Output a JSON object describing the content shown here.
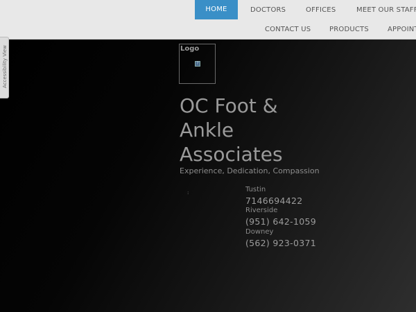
{
  "nav": {
    "row1": [
      "HOME",
      "DOCTORS",
      "OFFICES",
      "MEET OUR STAFF"
    ],
    "row2": [
      "CONTACT US",
      "PRODUCTS",
      "APPOINTM"
    ]
  },
  "accessibility_tab": "Accessibility View",
  "logo": {
    "label": "Logo",
    "broken_image_icon": "broken-image-icon"
  },
  "hero": {
    "title": "OC Foot & Ankle Associates",
    "tagline": "Experience, Dedication, Compassion",
    "small_mark": ":"
  },
  "locations": [
    {
      "name": "Tustin",
      "phone": "7146694422"
    },
    {
      "name": "Riverside",
      "phone": "(951) 642-1059"
    },
    {
      "name": "Downey",
      "phone": "(562) 923-0371"
    }
  ],
  "colors": {
    "active_nav": "#3a8fc7",
    "nav_bg": "#e8e8e8",
    "hero_bg": "#000000"
  }
}
